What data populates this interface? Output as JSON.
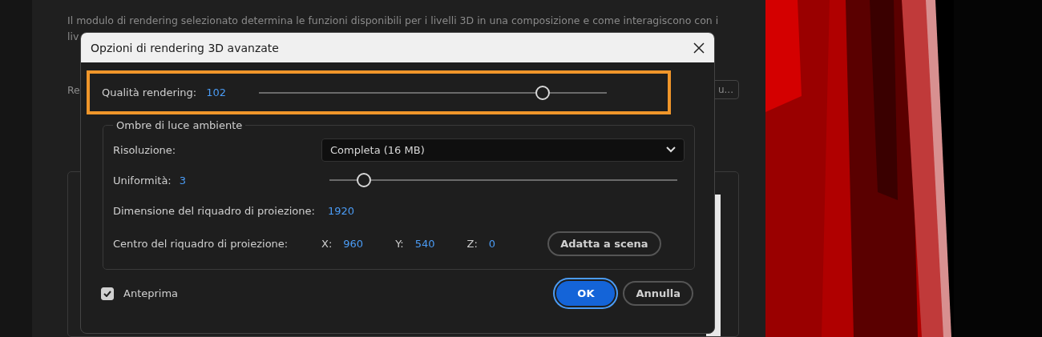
{
  "background": {
    "description_line": "Il modulo di rendering selezionato determina le funzioni disponibili per i livelli 3D in una composizione e come interagiscono con i",
    "description_cut": "liv",
    "label_cut": "Re",
    "button_cut": "u..."
  },
  "dialog": {
    "title": "Opzioni di rendering 3D avanzate",
    "quality": {
      "label": "Qualità rendering:",
      "value": "102",
      "level": 0.816,
      "highlighted": true
    },
    "group": {
      "title": "Ombre di luce ambiente",
      "resolution": {
        "label": "Risoluzione:",
        "value": "Completa (16 MB)"
      },
      "uniformity": {
        "label": "Uniformità:",
        "value": "3",
        "level": 0.1
      },
      "size": {
        "label": "Dimensione del riquadro di proiezione:",
        "value": "1920"
      },
      "center": {
        "label": "Centro del riquadro di proiezione:",
        "coords": [
          {
            "axis": "X:",
            "value": "960"
          },
          {
            "axis": "Y:",
            "value": "540"
          },
          {
            "axis": "Z:",
            "value": "0"
          }
        ],
        "button": "Adatta a scena"
      }
    },
    "preview": {
      "label": "Anteprima",
      "checked": true
    },
    "buttons": [
      {
        "label": "OK",
        "kind": "primary"
      },
      {
        "label": "Annulla",
        "kind": "secondary"
      }
    ]
  }
}
